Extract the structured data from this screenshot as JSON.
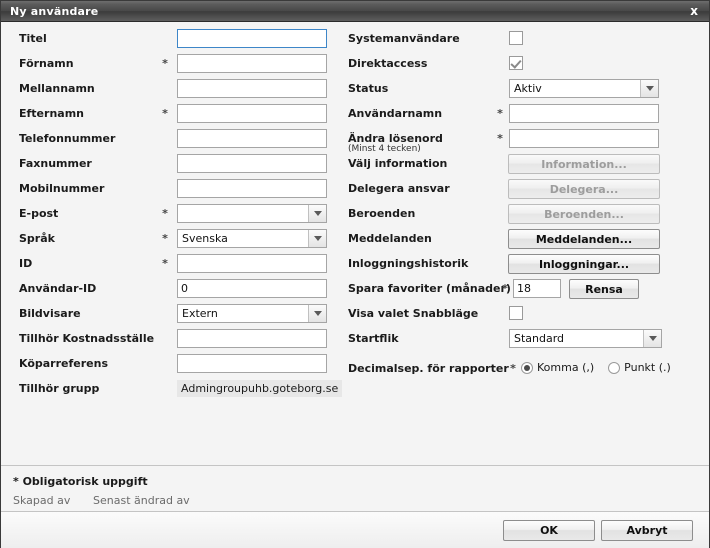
{
  "window": {
    "title": "Ny användare",
    "close_label": "x"
  },
  "left_column": [
    {
      "label": "Titel",
      "required": false,
      "control": "text",
      "value": "",
      "focused": true
    },
    {
      "label": "Förnamn",
      "required": true,
      "control": "text",
      "value": ""
    },
    {
      "label": "Mellannamn",
      "required": false,
      "control": "text",
      "value": ""
    },
    {
      "label": "Efternamn",
      "required": true,
      "control": "text",
      "value": ""
    },
    {
      "label": "Telefonnummer",
      "required": false,
      "control": "text",
      "value": ""
    },
    {
      "label": "Faxnummer",
      "required": false,
      "control": "text",
      "value": ""
    },
    {
      "label": "Mobilnummer",
      "required": false,
      "control": "text",
      "value": ""
    },
    {
      "label": "E-post",
      "required": true,
      "control": "select",
      "value": ""
    },
    {
      "label": "Språk",
      "required": true,
      "control": "select",
      "value": "Svenska"
    },
    {
      "label": "ID",
      "required": true,
      "control": "text",
      "value": ""
    },
    {
      "label": "Användar-ID",
      "required": false,
      "control": "text",
      "value": "0"
    },
    {
      "label": "Bildvisare",
      "required": false,
      "control": "select",
      "value": "Extern"
    },
    {
      "label": "Tillhör Kostnadsställe",
      "required": false,
      "control": "text",
      "value": ""
    },
    {
      "label": "Köparreferens",
      "required": false,
      "control": "text",
      "value": ""
    },
    {
      "label": "Tillhör grupp",
      "required": false,
      "control": "readonly",
      "value": "Admingroupuhb.goteborg.se"
    }
  ],
  "right_column": [
    {
      "label": "Systemanvändare",
      "required": false,
      "control": "checkbox",
      "checked": false
    },
    {
      "label": "Direktaccess",
      "required": false,
      "control": "checkbox",
      "checked": true
    },
    {
      "label": "Status",
      "required": false,
      "control": "select",
      "value": "Aktiv"
    },
    {
      "label": "Användarnamn",
      "required": true,
      "control": "text",
      "value": ""
    },
    {
      "label": "Ändra lösenord",
      "sublabel": "(Minst 4 tecken)",
      "required": true,
      "control": "text",
      "value": ""
    },
    {
      "label": "Välj information",
      "required": false,
      "control": "button",
      "button_label": "Information...",
      "disabled": true
    },
    {
      "label": "Delegera ansvar",
      "required": false,
      "control": "button",
      "button_label": "Delegera...",
      "disabled": true
    },
    {
      "label": "Beroenden",
      "required": false,
      "control": "button",
      "button_label": "Beroenden...",
      "disabled": true
    },
    {
      "label": "Meddelanden",
      "required": false,
      "control": "button",
      "button_label": "Meddelanden...",
      "disabled": false
    },
    {
      "label": "Inloggningshistorik",
      "required": false,
      "control": "button",
      "button_label": "Inloggningar...",
      "disabled": false
    }
  ],
  "favorites_row": {
    "label": "Spara favoriter (månader)",
    "required": true,
    "value": "18",
    "clear_button_label": "Rensa"
  },
  "quickmode_row": {
    "label": "Visa valet Snabbläge",
    "checked": false
  },
  "startflik_row": {
    "label": "Startflik",
    "value": "Standard"
  },
  "decimal_row": {
    "label": "Decimalsep. för rapporter",
    "required": true,
    "options": [
      {
        "label": "Komma (,)",
        "selected": true
      },
      {
        "label": "Punkt (.)",
        "selected": false
      }
    ]
  },
  "footer": {
    "required_note": "* Obligatorisk uppgift",
    "created_by_label": "Skapad av",
    "modified_by_label": "Senast ändrad av"
  },
  "buttons": {
    "ok": "OK",
    "cancel": "Avbryt"
  },
  "colors": {
    "focus_border": "#3d86c8",
    "titlebar_dark": "#3b3b3b",
    "dialog_bg": "#f4f4f4",
    "readonly_bg": "#e7e7e7"
  }
}
